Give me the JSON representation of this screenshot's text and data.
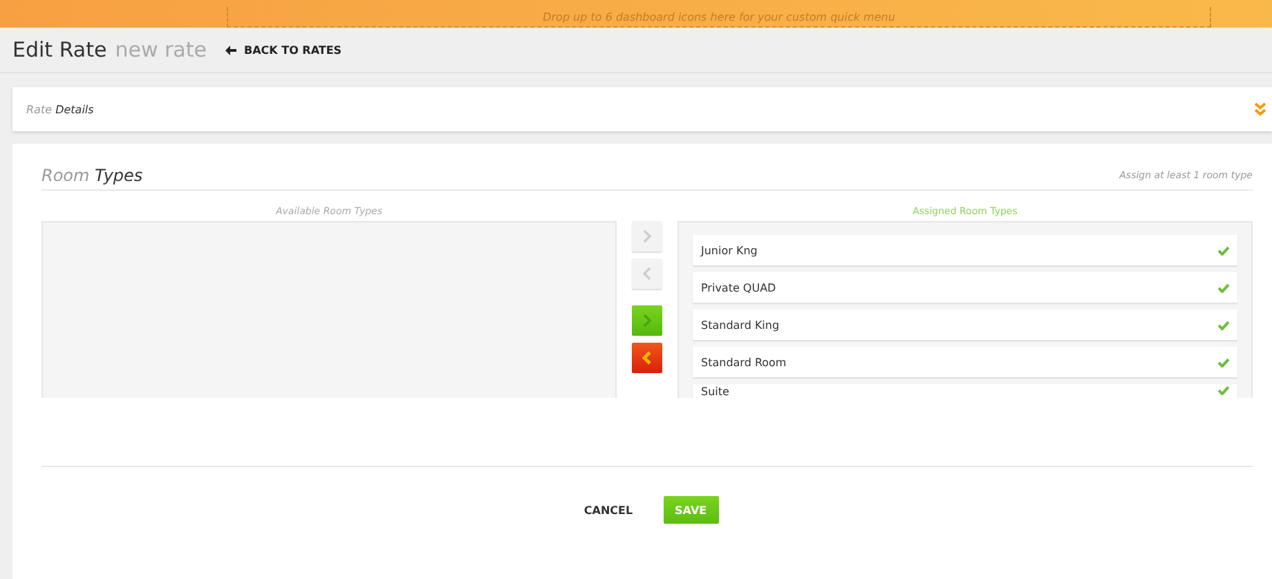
{
  "banner": {
    "text": "Drop up to 6 dashboard icons here for your custom quick menu"
  },
  "header": {
    "title": "Edit Rate",
    "subtitle": "new rate",
    "back_link": "BACK TO RATES"
  },
  "rate_details": {
    "label_light": "Rate",
    "label_bold": "Details",
    "expanded": false
  },
  "room_types": {
    "title_light": "Room",
    "title_bold": "Types",
    "hint": "Assign at least 1 room type",
    "available": {
      "heading": "Available Room Types"
    },
    "transfer_buttons": [
      {
        "kind": "right",
        "disabled": true
      },
      {
        "kind": "left",
        "disabled": true
      },
      {
        "kind": "right",
        "disabled": false
      },
      {
        "kind": "left",
        "disabled": false
      }
    ],
    "assigned": {
      "heading": "Assigned Room Types",
      "items": [
        {
          "name": "Junior Kng",
          "checked": true
        },
        {
          "name": "Private QUAD",
          "checked": true
        },
        {
          "name": "Standard King",
          "checked": true
        },
        {
          "name": "Standard Room",
          "checked": true
        },
        {
          "name": "Suite",
          "checked": true
        }
      ]
    }
  },
  "footer": {
    "buttons": [
      {
        "label": "CANCEL",
        "kind": "secondary"
      },
      {
        "label": "SAVE",
        "kind": "primary"
      }
    ]
  }
}
